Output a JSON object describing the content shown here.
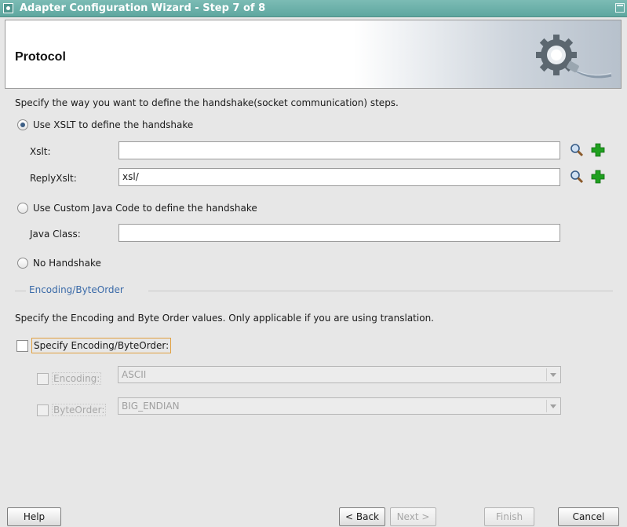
{
  "window": {
    "title": "Adapter Configuration Wizard - Step 7 of 8"
  },
  "header": {
    "title": "Protocol",
    "graphic_icon": "gear-plug-icon"
  },
  "handshake": {
    "description": "Specify the way you want to define the handshake(socket communication) steps.",
    "xslt_option": {
      "label": "Use XSLT to define the handshake",
      "selected": true,
      "xslt_label": "Xslt:",
      "xslt_value": "",
      "reply_label": "ReplyXslt:",
      "reply_value": "xsl/"
    },
    "java_option": {
      "label": "Use Custom Java Code to define the handshake",
      "selected": false,
      "class_label": "Java Class:",
      "class_value": ""
    },
    "none_option": {
      "label": "No Handshake",
      "selected": false
    }
  },
  "encoding_section": {
    "title": "Encoding/ByteOrder",
    "description": "Specify the Encoding and Byte Order values. Only applicable if you are using translation.",
    "specify_label": "Specify Encoding/ByteOrder:",
    "encoding_label": "Encoding:",
    "encoding_value": "ASCII",
    "byteorder_label": "ByteOrder:",
    "byteorder_value": "BIG_ENDIAN"
  },
  "buttons": {
    "help": "Help",
    "back": "< Back",
    "next": "Next >",
    "finish": "Finish",
    "cancel": "Cancel"
  },
  "colors": {
    "titlebar": "#6fb1aa",
    "section_link": "#3a6aa8",
    "focus_outline": "#e0a040",
    "add_icon_green": "#1fa01f"
  }
}
